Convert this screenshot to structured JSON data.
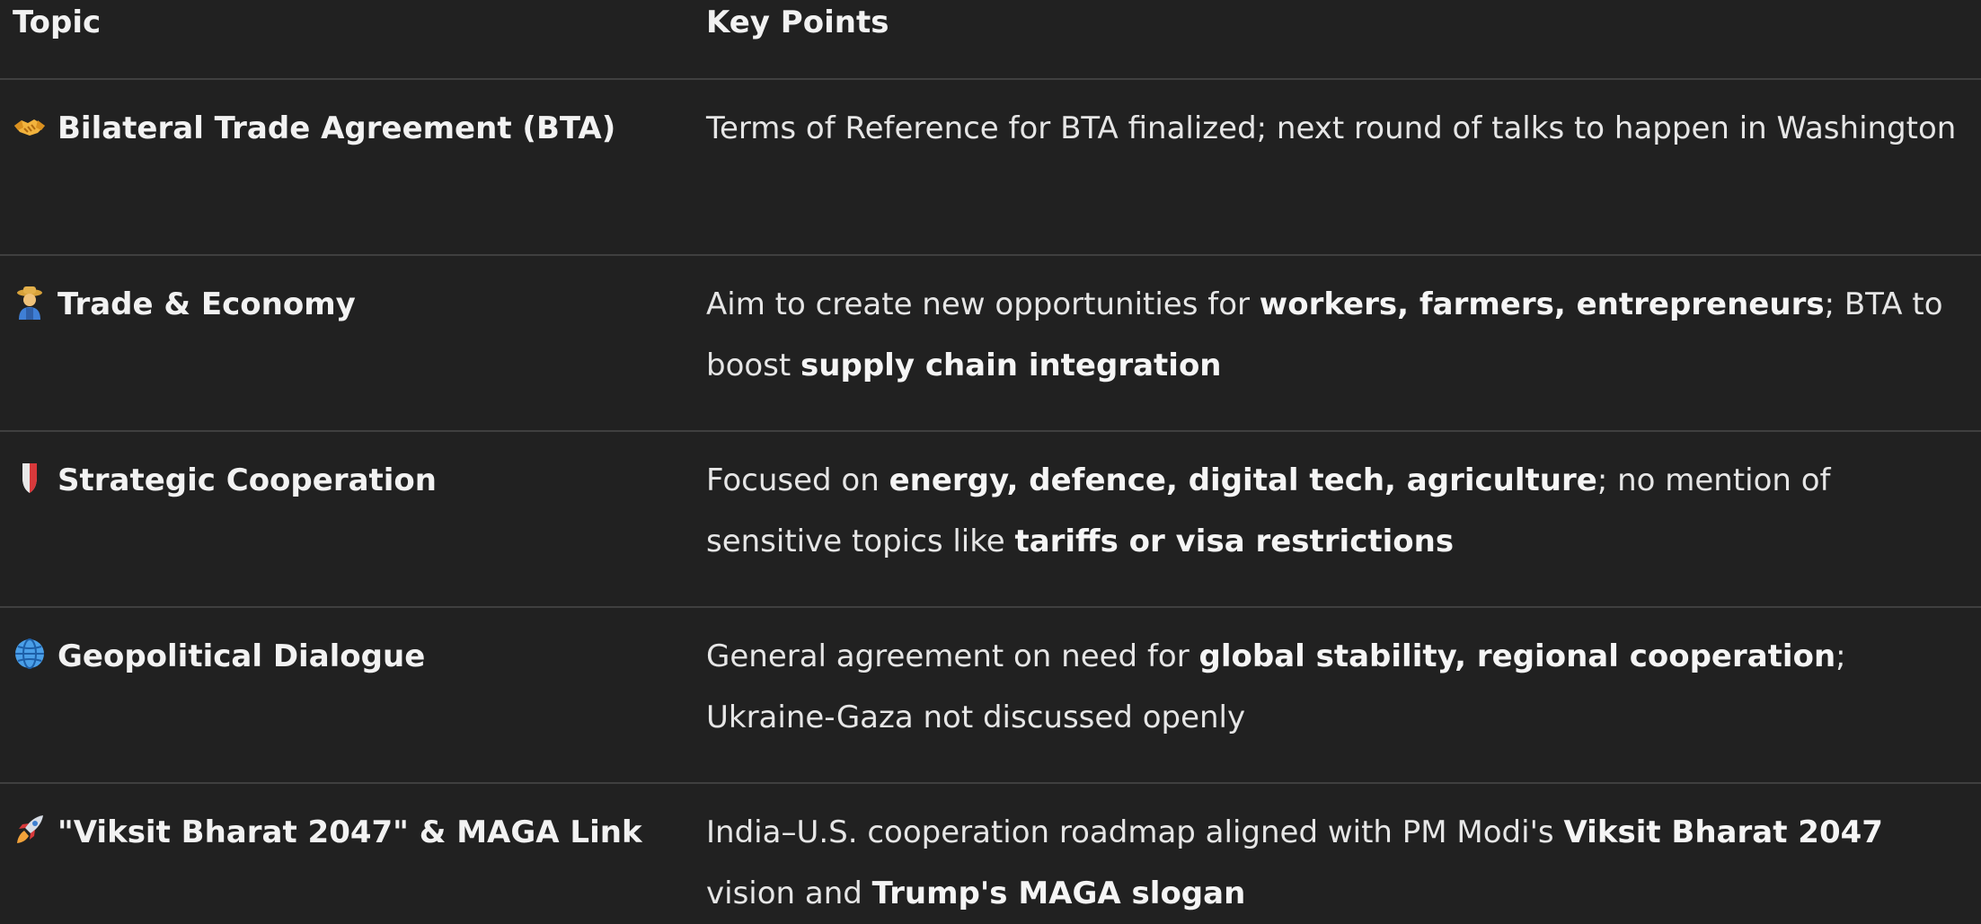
{
  "header": {
    "topic": "Topic",
    "key_points": "Key Points"
  },
  "rows": [
    {
      "icon": "handshake-icon",
      "topic": "Bilateral Trade Agreement (BTA)",
      "parts": [
        {
          "t": "Terms of Reference for BTA finalized; next round of talks to happen in Washington",
          "b": false
        }
      ]
    },
    {
      "icon": "farmer-icon",
      "topic": "Trade & Economy",
      "parts": [
        {
          "t": "Aim to create new opportunities for ",
          "b": false
        },
        {
          "t": "workers, farmers, entrepreneurs",
          "b": true
        },
        {
          "t": "; BTA to boost ",
          "b": false
        },
        {
          "t": "supply chain integration",
          "b": true
        }
      ]
    },
    {
      "icon": "shield-icon",
      "topic": "Strategic Cooperation",
      "parts": [
        {
          "t": "Focused on ",
          "b": false
        },
        {
          "t": "energy, defence, digital tech, agriculture",
          "b": true
        },
        {
          "t": "; no mention of sensitive topics like ",
          "b": false
        },
        {
          "t": "tariffs or visa restrictions",
          "b": true
        }
      ]
    },
    {
      "icon": "globe-icon",
      "topic": "Geopolitical Dialogue",
      "parts": [
        {
          "t": "General agreement on need for ",
          "b": false
        },
        {
          "t": "global stability, regional cooperation",
          "b": true
        },
        {
          "t": "; Ukraine-Gaza not discussed openly",
          "b": false
        }
      ]
    },
    {
      "icon": "rocket-icon",
      "topic": "\"Viksit Bharat 2047\" & MAGA Link",
      "parts": [
        {
          "t": "India–U.S. cooperation roadmap aligned with PM Modi's ",
          "b": false
        },
        {
          "t": "Viksit Bharat 2047",
          "b": true
        },
        {
          "t": " vision and ",
          "b": false
        },
        {
          "t": "Trump's MAGA slogan",
          "b": true
        }
      ]
    }
  ]
}
